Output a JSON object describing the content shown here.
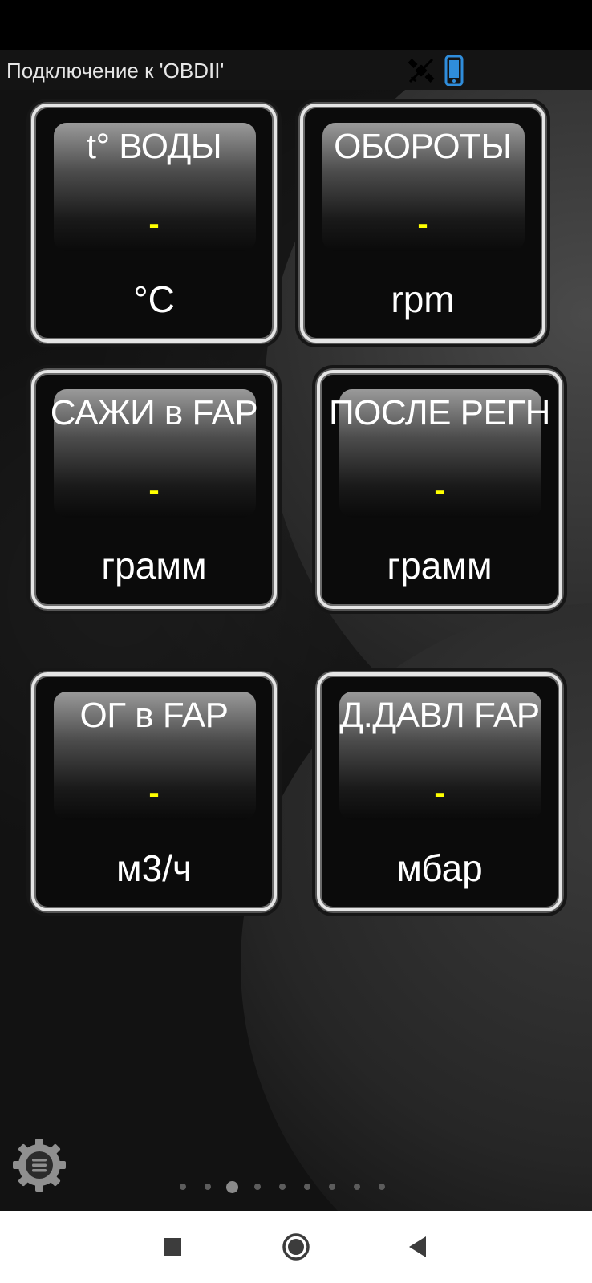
{
  "connection": {
    "text": "Подключение к 'OBDII'",
    "gps_icon": "gps-off-icon",
    "phone_icon": "phone-icon",
    "phone_icon_color": "#2f8ddb"
  },
  "gauges": [
    {
      "title": "t° ВОДЫ",
      "value": "-",
      "unit": "°C"
    },
    {
      "title": "ОБОРОТЫ",
      "value": "-",
      "unit": "rpm"
    },
    {
      "title": "САЖИ в FAP",
      "value": "-",
      "unit": "грамм"
    },
    {
      "title": "ПОСЛЕ РЕГН",
      "value": "-",
      "unit": "грамм"
    },
    {
      "title": "ОГ в FAP",
      "value": "-",
      "unit": "м3/ч"
    },
    {
      "title": "Д.ДАВЛ FAP",
      "value": "-",
      "unit": "мбар"
    }
  ],
  "settings_icon": "gear-menu-icon",
  "page_indicator": {
    "count": 9,
    "active_index": 2
  },
  "navigation": {
    "recents_icon": "square-icon",
    "home_icon": "circle-icon",
    "back_icon": "triangle-back-icon"
  },
  "colors": {
    "value_color": "#ffff00",
    "gauge_border": "#e5e5e5",
    "text": "#ffffff"
  }
}
